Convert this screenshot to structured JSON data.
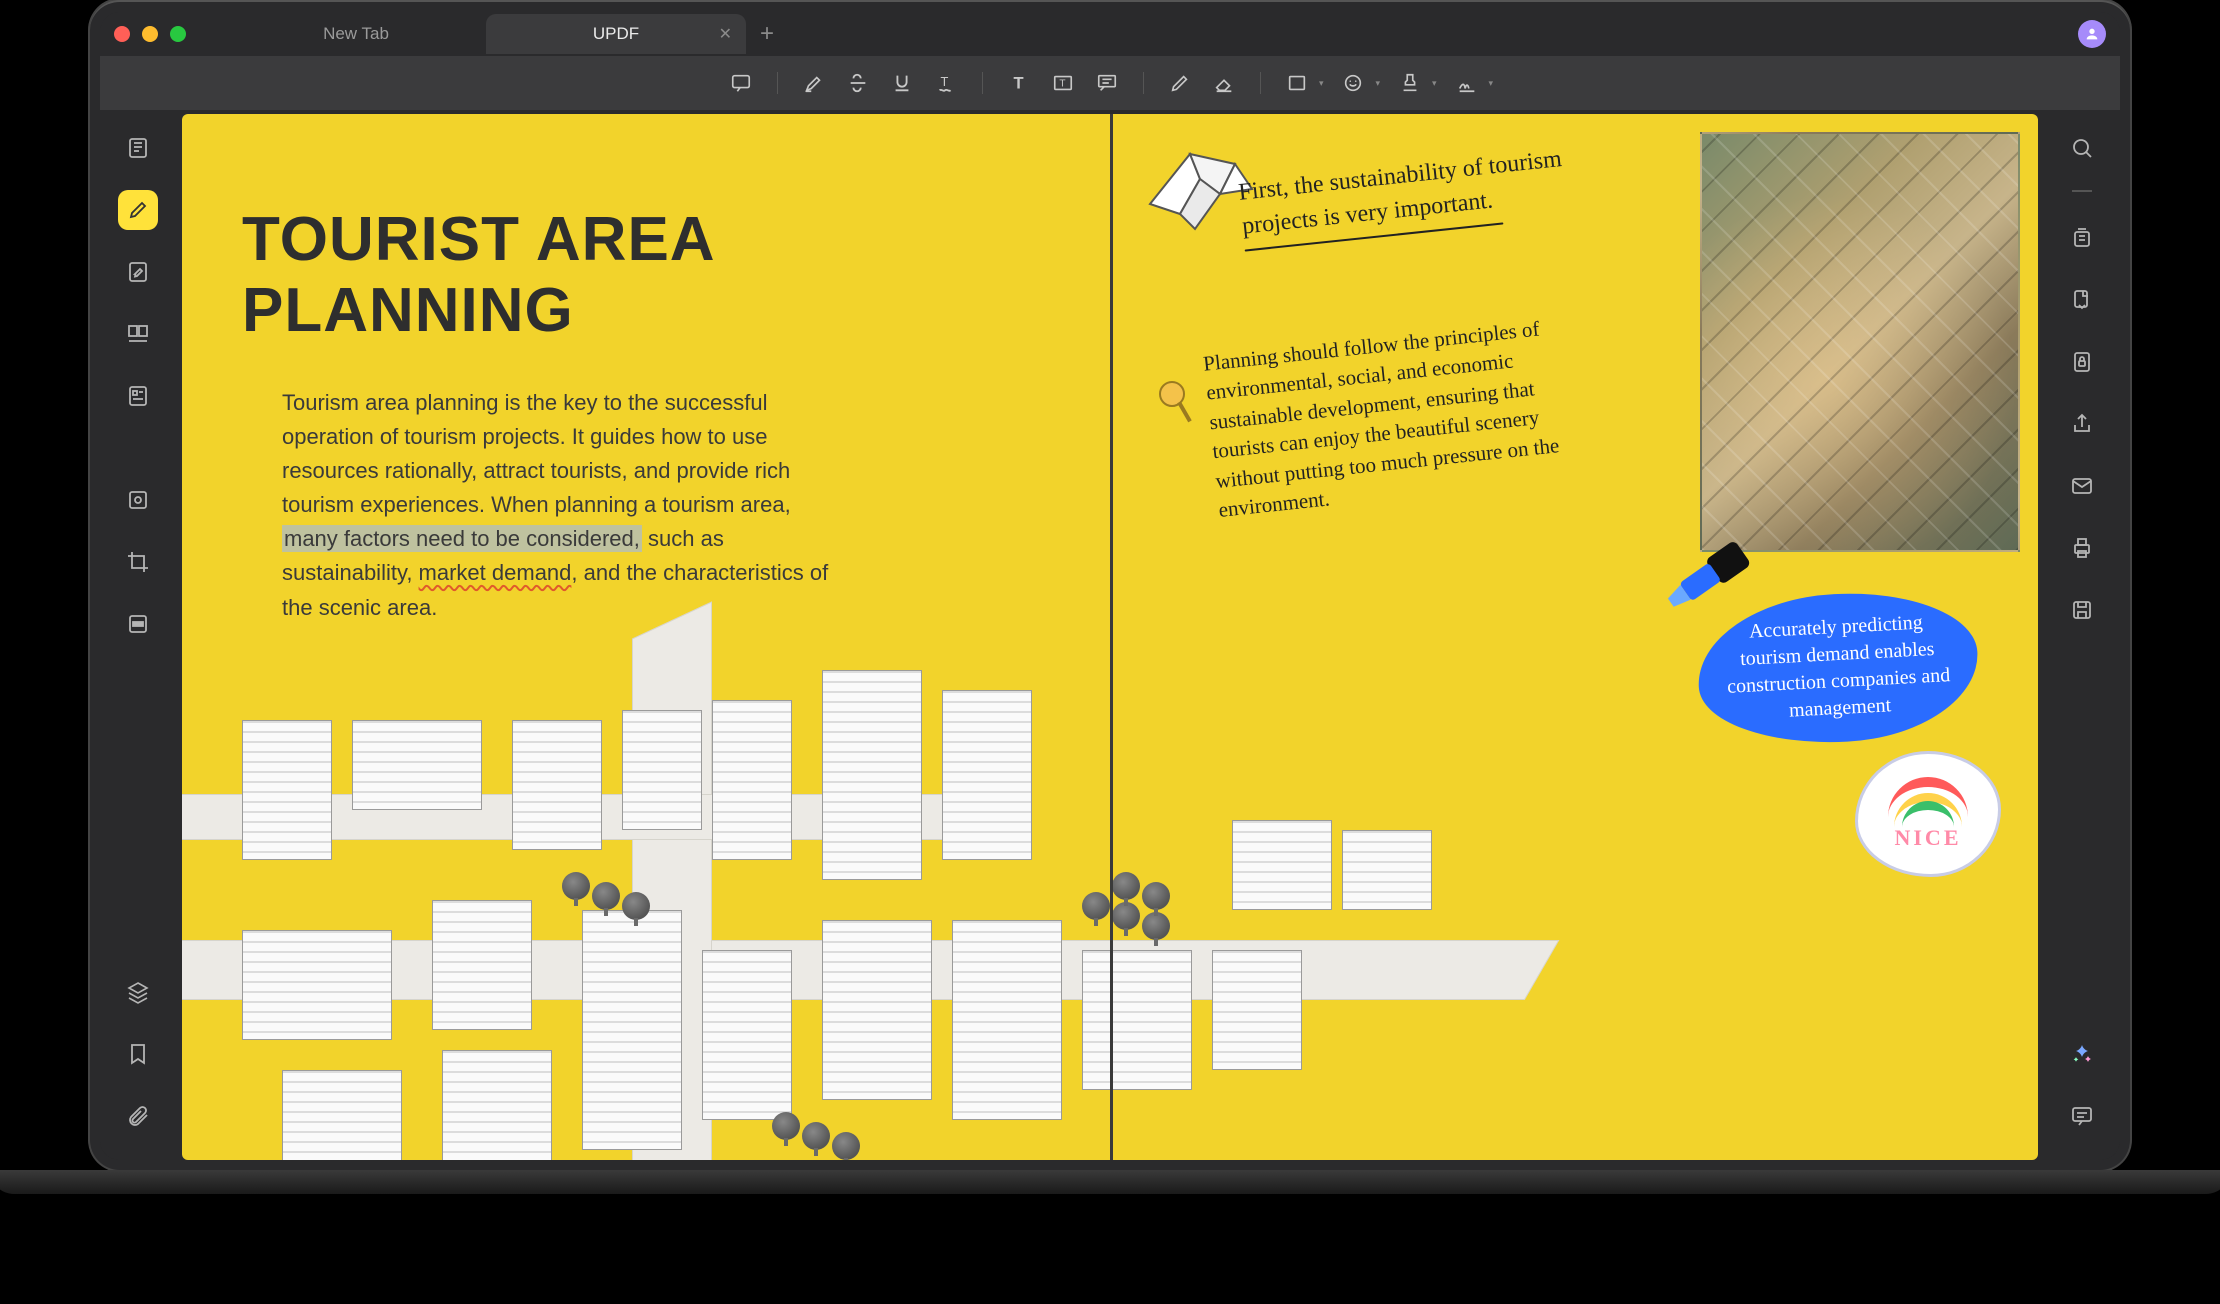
{
  "tabs": {
    "inactive": "New Tab",
    "active": "UPDF"
  },
  "document": {
    "title": "TOURIST AREA PLANNING",
    "paragraph_pre": "Tourism area planning is the key to the successful operation of tourism projects.  It guides how to use resources rationally, attract tourists, and provide rich tourism experiences. When planning a tourism area, ",
    "paragraph_highlight": "many factors need to be considered,",
    "paragraph_mid": " such as sustainability, ",
    "paragraph_squiggle": "market demand",
    "paragraph_post": ", and the characteristics of the scenic area."
  },
  "annotations": {
    "note1": "First, the sustainability of tourism projects is very important.",
    "note2": "Planning should follow the principles of environmental, social, and economic sustainable development, ensuring that tourists can enjoy the beautiful scenery without putting too much pressure on the environment.",
    "blue_note": "Accurately predicting tourism demand enables construction companies and management",
    "sticker_label": "NICE"
  },
  "left_tools": {
    "reader": "reader-icon",
    "annotate": "annotate-icon",
    "edit": "edit-pdf-icon",
    "organize": "organize-pages-icon",
    "form": "form-icon",
    "ocr": "ocr-icon",
    "crop": "crop-icon",
    "redact": "redact-icon"
  },
  "left_bottom": {
    "layers": "layers-icon",
    "bookmark": "bookmark-icon",
    "attachment": "attachment-icon"
  },
  "right_tools": {
    "search": "search-icon",
    "compress": "compress-icon",
    "convert": "convert-icon",
    "protect": "protect-icon",
    "share": "share-icon",
    "mail": "mail-icon",
    "print": "print-icon",
    "save": "save-icon"
  },
  "right_bottom": {
    "ai": "ai-icon",
    "comments": "comments-panel-icon"
  },
  "toolbar": {
    "comment": "comment-icon",
    "highlight": "highlighter-icon",
    "strike": "strikethrough-icon",
    "underline": "underline-icon",
    "text": "text-icon",
    "textbox": "textbox-icon",
    "typewriter": "typewriter-icon",
    "callout": "text-callout-icon",
    "pencil": "pencil-icon",
    "eraser": "eraser-icon",
    "shape": "rectangle-icon",
    "sticker": "sticker-icon",
    "stamp": "stamp-icon",
    "signature": "signature-icon"
  }
}
